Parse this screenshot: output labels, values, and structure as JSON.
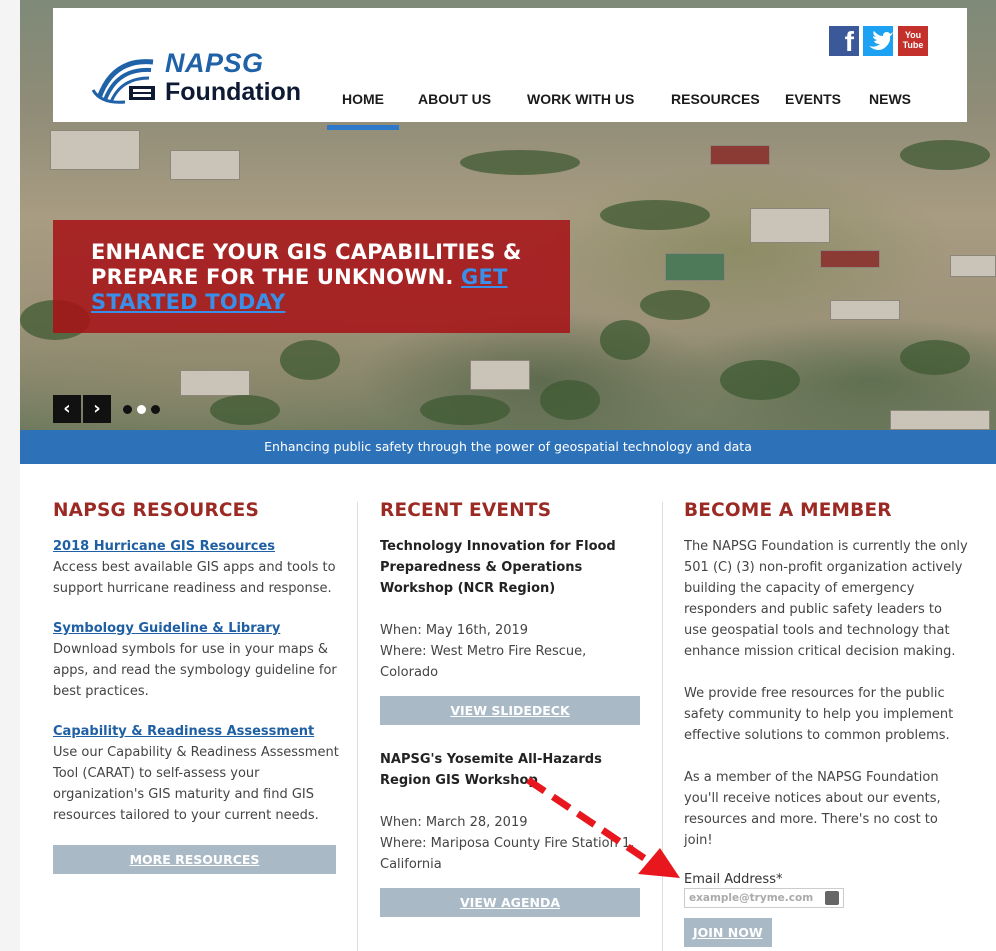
{
  "header": {
    "logo_line1": "NAPSG",
    "logo_line2": "Foundation",
    "social": [
      {
        "name": "facebook",
        "glyph": "f"
      },
      {
        "name": "twitter",
        "glyph": "🐦"
      },
      {
        "name": "youtube",
        "glyph": "You Tube"
      }
    ],
    "nav": [
      "HOME",
      "ABOUT US",
      "WORK WITH US",
      "RESOURCES",
      "EVENTS",
      "NEWS"
    ]
  },
  "hero": {
    "headline": "ENHANCE YOUR GIS CAPABILITIES & PREPARE FOR THE UNKNOWN. ",
    "cta_link": "GET STARTED TODAY",
    "prev_glyph": "‹",
    "next_glyph": "›"
  },
  "tagline": "Enhancing public safety through the power of geospatial technology and data",
  "resources": {
    "heading": "NAPSG RESOURCES",
    "items": [
      {
        "link": "2018 Hurricane GIS Resources ",
        "desc": "Access best available GIS apps and tools to support hurricane readiness and response."
      },
      {
        "link": "Symbology Guideline & Library ",
        "desc": "Download symbols for use in your maps & apps, and read the symbology guideline for best practices."
      },
      {
        "link": "Capability & Readiness Assessment",
        "desc": "Use our Capability & Readiness Assessment Tool (CARAT) to self-assess your organization's GIS maturity and find GIS resources tailored to your current needs."
      }
    ],
    "button": "MORE RESOURCES"
  },
  "events": {
    "heading": "RECENT EVENTS",
    "items": [
      {
        "title": "Technology Innovation for Flood Preparedness & Operations Workshop (NCR Region)",
        "when": "When: May 16th, 2019",
        "where": "Where: West Metro Fire Rescue, Colorado",
        "button": "VIEW SLIDEDECK"
      },
      {
        "title": "NAPSG's Yosemite All-Hazards Region GIS Workshop",
        "when": "When: March 28, 2019",
        "where": "Where: Mariposa County Fire Station 1, California",
        "button": "VIEW AGENDA"
      }
    ]
  },
  "member": {
    "heading": "BECOME A MEMBER",
    "paragraphs": [
      "The NAPSG Foundation is currently the only 501 (C) (3) non-profit organization actively building the capacity of emergency responders and public safety leaders to use geospatial tools and technology that enhance mission critical decision making.",
      "We provide free resources for the public safety community to help you implement effective solutions to common problems.",
      "As a member of the NAPSG Foundation you'll receive notices about our events, resources and more. There's no cost to join!"
    ],
    "email_label": "Email Address*",
    "email_placeholder": "example@tryme.com",
    "join_button": "JOIN NOW"
  },
  "colors": {
    "heading_red": "#9c2a24",
    "link_blue": "#1f5fa3",
    "bar_blue": "#2d72b9",
    "banner_red": "#a71216",
    "button_grey": "#a9b9c5",
    "annotation_red": "#e8161d"
  }
}
